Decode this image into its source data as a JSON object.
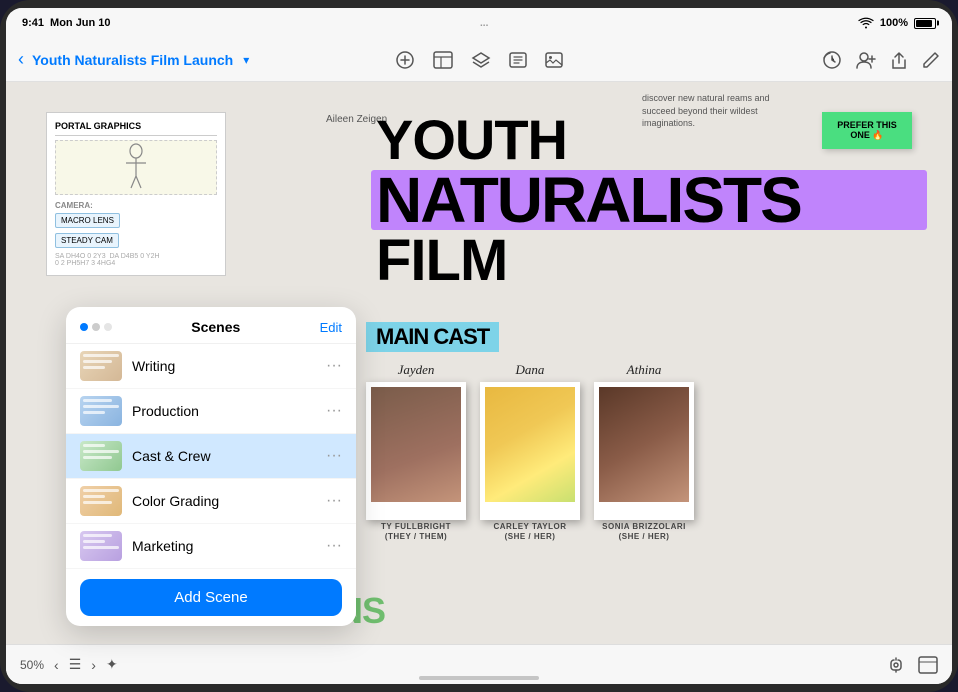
{
  "status_bar": {
    "time": "9:41",
    "day": "Mon Jun 10",
    "dots": "...",
    "wifi": "WiFi",
    "battery_pct": "100%"
  },
  "toolbar": {
    "back_label": "‹",
    "title": "Youth Naturalists Film Launch",
    "title_chevron": "▾",
    "icons": [
      "circle_icon",
      "square_icon",
      "layers_icon",
      "text_icon",
      "image_icon"
    ],
    "right_icons": [
      "clock_icon",
      "person_plus_icon",
      "share_icon",
      "edit_icon"
    ]
  },
  "canvas": {
    "aileen_label": "Aileen Zeigen",
    "text_note": "discover new natural reams and succeed beyond their wildest imaginations.",
    "sticky_note": {
      "text": "PREFER THIS ONE 🔥"
    },
    "title_lines": {
      "youth": "YOUTH",
      "naturalists": "NATURALISTS",
      "film": "FILM"
    },
    "main_cast_label": "Main Cast",
    "cast_members": [
      {
        "script_name": "Jayden",
        "name_caps": "TY FULLBRIGHT",
        "pronoun": "(THEY / THEM)"
      },
      {
        "script_name": "Dana",
        "name_caps": "CARLEY TAYLOR",
        "pronoun": "(SHE / HER)"
      },
      {
        "script_name": "Athina",
        "name_caps": "SONIA BRIZZOLARI",
        "pronoun": "(SHE / HER)"
      }
    ],
    "sketch_card": {
      "header": "PORTAL GRAPHICS",
      "camera_label": "CAMERA:",
      "lens_options": [
        "MACRO LENS",
        "STEADY CAM"
      ]
    }
  },
  "scenes_panel": {
    "title": "Scenes",
    "edit_btn": "Edit",
    "items": [
      {
        "name": "Writing",
        "active": false
      },
      {
        "name": "Production",
        "active": false
      },
      {
        "name": "Cast & Crew",
        "active": true
      },
      {
        "name": "Color Grading",
        "active": false
      },
      {
        "name": "Marketing",
        "active": false
      }
    ],
    "add_scene_label": "Add Scene"
  },
  "bottom_bar": {
    "zoom": "50%",
    "back_arrow": "‹",
    "fwd_arrow": "›",
    "list_icon": "☰",
    "star_icon": "✦"
  }
}
